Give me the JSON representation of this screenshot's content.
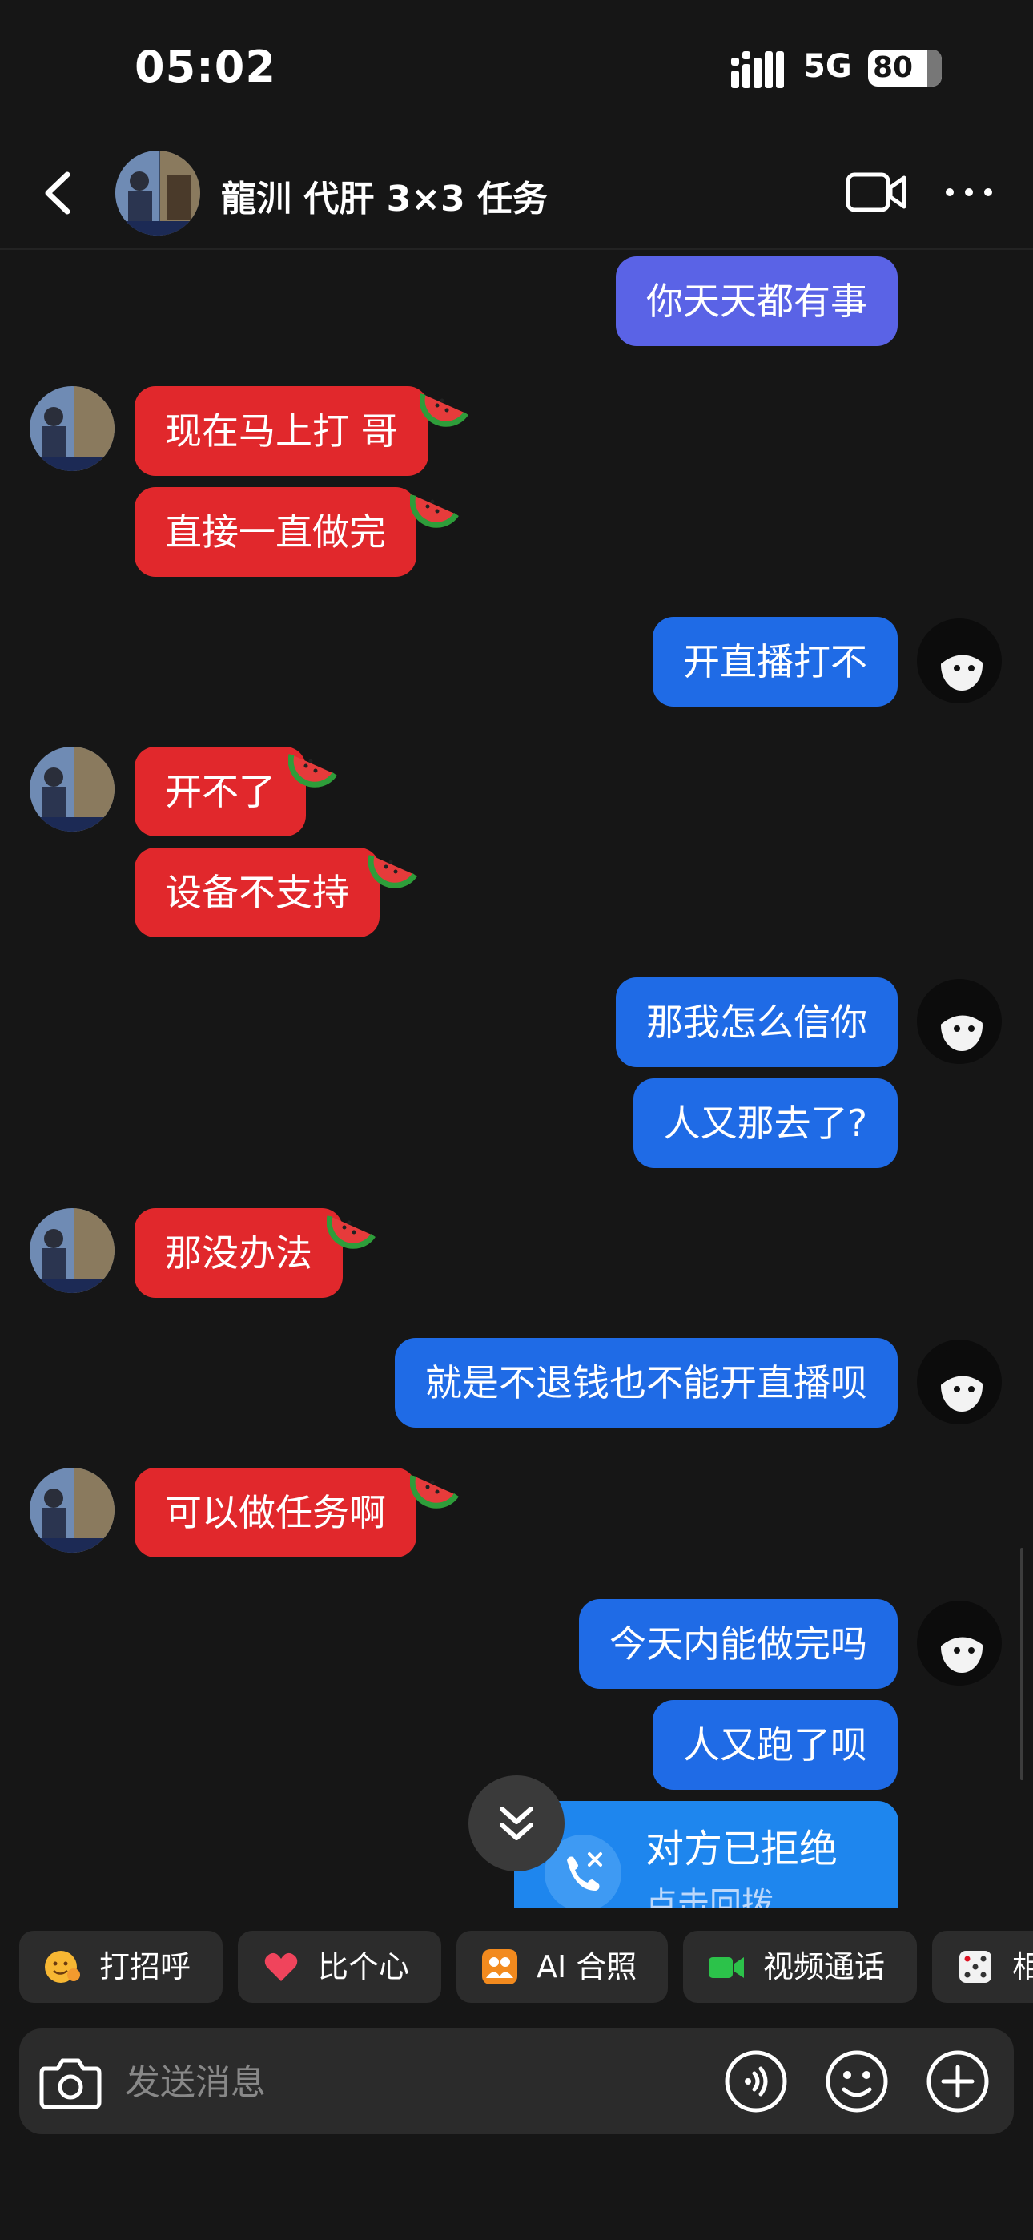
{
  "status_bar": {
    "time": "05:02",
    "network": "5G",
    "battery": "80"
  },
  "header": {
    "title": "龍汌 代肝 3×3 任务"
  },
  "messages": [
    {
      "side": "out",
      "text": "你天天都有事"
    },
    {
      "side": "in",
      "text": "现在马上打 哥"
    },
    {
      "side": "in",
      "text": "直接一直做完"
    },
    {
      "side": "out",
      "text": "开直播打不"
    },
    {
      "side": "in",
      "text": "开不了"
    },
    {
      "side": "in",
      "text": "设备不支持"
    },
    {
      "side": "out",
      "text": "那我怎么信你"
    },
    {
      "side": "out",
      "text": "人又那去了?"
    },
    {
      "side": "in",
      "text": "那没办法"
    },
    {
      "side": "out",
      "text": "就是不退钱也不能开直播呗"
    },
    {
      "side": "in",
      "text": "可以做任务啊"
    },
    {
      "side": "out",
      "text": "今天内能做完吗"
    },
    {
      "side": "out",
      "text": "人又跑了呗"
    }
  ],
  "call_card": {
    "title": "对方已拒绝",
    "subtitle": "点击回拨"
  },
  "quick_chips": [
    {
      "label": "打招呼",
      "icon": "wave-emoji-icon"
    },
    {
      "label": "比个心",
      "icon": "heart-icon"
    },
    {
      "label": "AI 合照",
      "icon": "ai-photo-icon"
    },
    {
      "label": "视频通话",
      "icon": "video-call-icon"
    },
    {
      "label": "相",
      "icon": "dice-icon"
    }
  ],
  "input": {
    "placeholder": "发送消息"
  },
  "colors": {
    "outgoing": "#1f6be6",
    "outgoing_first": "#5a63e6",
    "incoming": "#e1282c",
    "background": "#161616"
  }
}
